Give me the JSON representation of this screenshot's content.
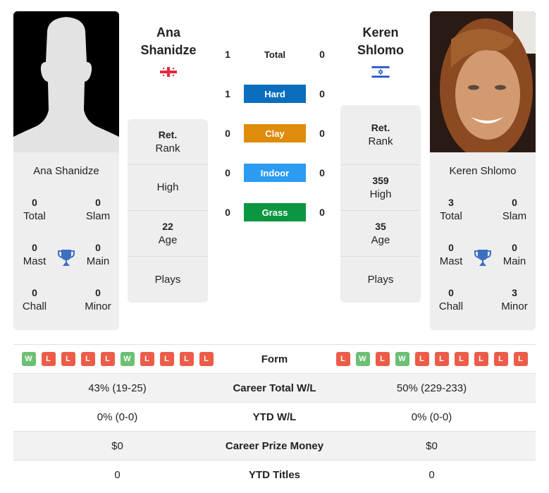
{
  "player1": {
    "name_line1": "Ana",
    "name_line2": "Shanidze",
    "full_name": "Ana Shanidze",
    "flag": "georgia-flag-icon",
    "photo": "silhouette-placeholder",
    "titles": {
      "total": "0",
      "total_label": "Total",
      "slam": "0",
      "slam_label": "Slam",
      "mast": "0",
      "mast_label": "Mast",
      "main": "0",
      "main_label": "Main",
      "chall": "0",
      "chall_label": "Chall",
      "minor": "0",
      "minor_label": "Minor"
    },
    "info": {
      "rank_value": "Ret.",
      "rank_label": "Rank",
      "high_value": "",
      "high_label": "High",
      "age_value": "22",
      "age_label": "Age",
      "plays_value": "",
      "plays_label": "Plays"
    },
    "form": [
      "W",
      "L",
      "L",
      "L",
      "L",
      "W",
      "L",
      "L",
      "L",
      "L"
    ]
  },
  "player2": {
    "name_line1": "Keren",
    "name_line2": "Shlomo",
    "full_name": "Keren Shlomo",
    "flag": "israel-flag-icon",
    "photo": "player-photo",
    "titles": {
      "total": "3",
      "total_label": "Total",
      "slam": "0",
      "slam_label": "Slam",
      "mast": "0",
      "mast_label": "Mast",
      "main": "0",
      "main_label": "Main",
      "chall": "0",
      "chall_label": "Chall",
      "minor": "3",
      "minor_label": "Minor"
    },
    "info": {
      "rank_value": "Ret.",
      "rank_label": "Rank",
      "high_value": "359",
      "high_label": "High",
      "age_value": "35",
      "age_label": "Age",
      "plays_value": "",
      "plays_label": "Plays"
    },
    "form": [
      "L",
      "W",
      "L",
      "W",
      "L",
      "L",
      "L",
      "L",
      "L",
      "L"
    ]
  },
  "h2h": {
    "total": {
      "label": "Total",
      "p1": "1",
      "p2": "0"
    },
    "surfaces": [
      {
        "label": "Hard",
        "p1": "1",
        "p2": "0",
        "color": "#0a6ebd"
      },
      {
        "label": "Clay",
        "p1": "0",
        "p2": "0",
        "color": "#e08c0b"
      },
      {
        "label": "Indoor",
        "p1": "0",
        "p2": "0",
        "color": "#2b9cf2"
      },
      {
        "label": "Grass",
        "p1": "0",
        "p2": "0",
        "color": "#0d9642"
      }
    ]
  },
  "stats": {
    "form_label": "Form",
    "rows": [
      {
        "label": "Career Total W/L",
        "p1": "43% (19-25)",
        "p2": "50% (229-233)"
      },
      {
        "label": "YTD W/L",
        "p1": "0% (0-0)",
        "p2": "0% (0-0)"
      },
      {
        "label": "Career Prize Money",
        "p1": "$0",
        "p2": "$0"
      },
      {
        "label": "YTD Titles",
        "p1": "0",
        "p2": "0"
      }
    ]
  },
  "colors": {
    "win": "#6cbf73",
    "loss": "#ec5c48",
    "trophy": "#3b6fc0",
    "card_bg": "#eeeeee"
  }
}
